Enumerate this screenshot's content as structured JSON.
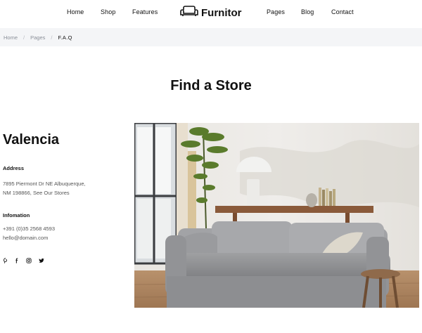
{
  "nav": {
    "left": [
      "Home",
      "Shop",
      "Features"
    ],
    "right": [
      "Pages",
      "Blog",
      "Contact"
    ]
  },
  "logo": {
    "text": "Furnitor",
    "icon": "sofa-icon"
  },
  "breadcrumb": {
    "items": [
      "Home",
      "Pages"
    ],
    "current": "F.A.Q",
    "separator": "/"
  },
  "page": {
    "title": "Find a Store"
  },
  "store": {
    "city": "Valencia",
    "address_label": "Address",
    "address_line1": "7895 Piermont Dr NE Albuquerque,",
    "address_line2": "NM 198866, See Our Stores",
    "info_label": "Infomation",
    "phone": "+391 (0)35 2568 4593",
    "email": "hello@domain.com",
    "social": [
      "pinterest-icon",
      "facebook-icon",
      "instagram-icon",
      "twitter-icon"
    ]
  },
  "colors": {
    "breadcrumb_bg": "#f4f5f7",
    "text": "#111111",
    "muted": "#555555"
  }
}
